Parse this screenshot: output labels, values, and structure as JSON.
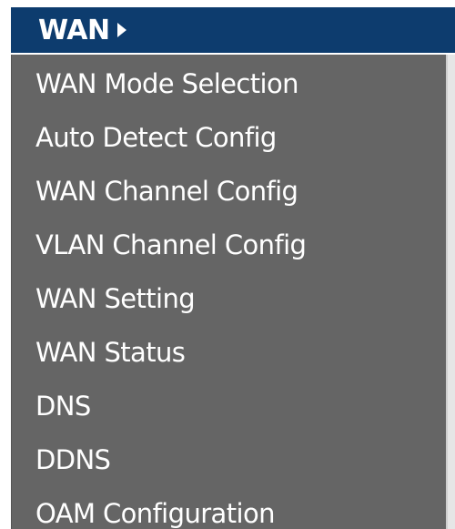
{
  "menu": {
    "header": {
      "label": "WAN"
    },
    "items": [
      {
        "label": "WAN Mode Selection"
      },
      {
        "label": "Auto Detect Config"
      },
      {
        "label": "WAN Channel Config"
      },
      {
        "label": "VLAN Channel Config"
      },
      {
        "label": "WAN Setting"
      },
      {
        "label": "WAN Status"
      },
      {
        "label": "DNS"
      },
      {
        "label": "DDNS"
      },
      {
        "label": "OAM Configuration"
      }
    ]
  },
  "colors": {
    "header_bg": "#0d3c6e",
    "body_bg": "#656565",
    "text": "#ffffff"
  },
  "icons": {
    "header_arrow": "caret-right-icon"
  }
}
